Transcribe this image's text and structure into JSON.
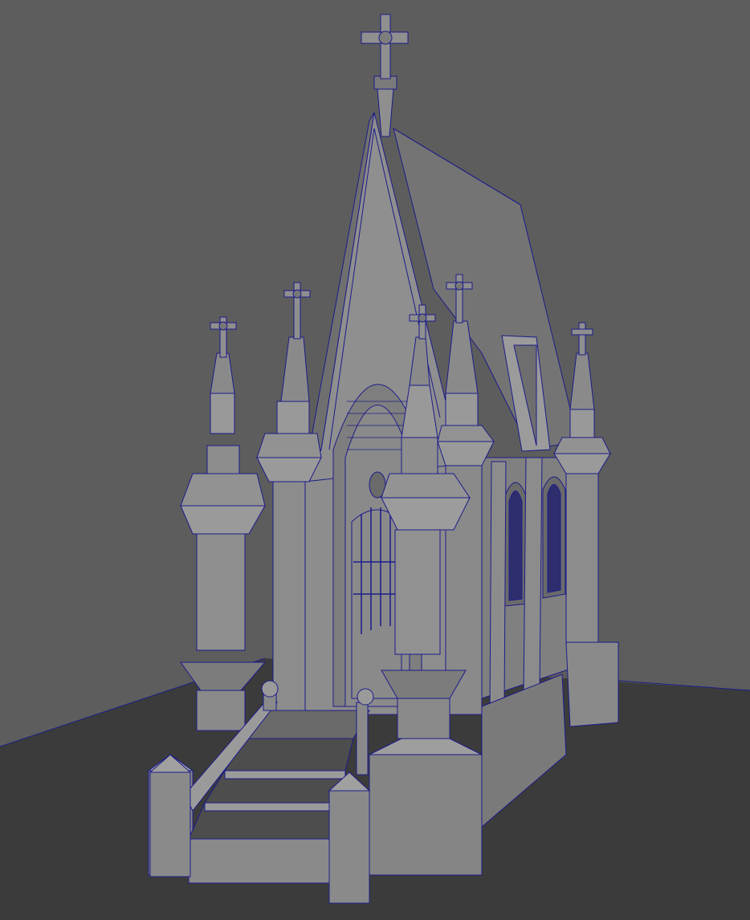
{
  "viewport": {
    "background_wall": "#5d5d5d",
    "floor": "#3a3a3a",
    "mesh_fill": "#8a8a8a",
    "mesh_light": "#9b9b9b",
    "mesh_dark": "#6b6b6b",
    "mesh_shadow": "#4f4f4f",
    "wire": "#1c1c8a",
    "window_glass": "#2a2a6a"
  },
  "model": {
    "subject": "gothic-chapel-mausoleum",
    "parts": [
      "spire-cross",
      "gable-roof",
      "pointed-arch-door",
      "pinnacle-left-front",
      "pinnacle-left-back",
      "pinnacle-center",
      "pinnacle-right-front",
      "pinnacle-right-back",
      "stairs",
      "stair-railing",
      "side-lancet-windows",
      "dormer",
      "plinth-base"
    ]
  }
}
